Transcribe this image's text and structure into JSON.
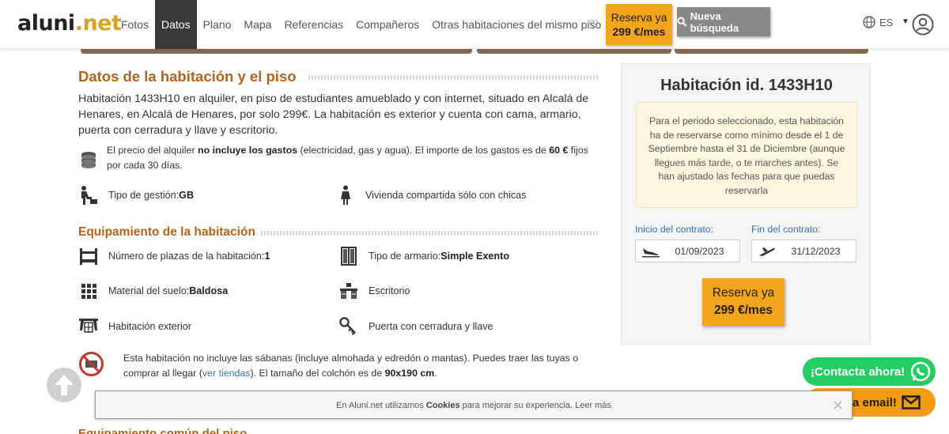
{
  "header": {
    "logo_text_left": "aluni",
    "logo_text_right": ".net",
    "nav": [
      "Fotos",
      "Datos",
      "Plano",
      "Mapa",
      "Referencias",
      "Compañeros",
      "Otras habitaciones del mismo piso"
    ],
    "active_nav": "Datos",
    "reserve_line1": "Reserva ya",
    "reserve_line2": "299 €/mes",
    "search_label": "Nueva búsqueda",
    "lang": "ES"
  },
  "section": {
    "title": "Datos de la habitación y el piso",
    "description": "Habitación 1433H10 en alquiler, en piso de estudiantes amueblado y con internet, situado en Alcalá de Henares, en Alcalá de Henares, por solo 299€. La habitación es exterior y cuenta con cama, armario, puerta con cerradura y llave y escritorio.",
    "price_note_a": "El precio del alquiler ",
    "price_note_b": "no incluye los gastos",
    "price_note_c": " (electricidad, gas y agua). El importe de los gastos es de ",
    "price_note_d": "60 €",
    "price_note_e": " fijos por cada 30 días.",
    "management_label": "Tipo de gestión: ",
    "management_value": "GB",
    "shared_label": "Vivienda compartida sólo con chicas"
  },
  "equipment": {
    "title": "Equipamiento de la habitación",
    "places_label": "Número de plazas de la habitación:",
    "places_value": "1",
    "wardrobe_label": "Tipo de armario:",
    "wardrobe_value": "Simple Exento",
    "floor_label": "Material del suelo:",
    "floor_value": "Baldosa",
    "desk_label": "Escritorio",
    "exterior_label": "Habitación exterior",
    "lock_label": "Puerta con cerradura y llave",
    "sheets_a": "Esta habitación no incluye las sábanas (incluye almohada y edredón o mantas). Puedes traer las tuyas o comprar al llegar (",
    "sheets_link": "ver tiendas",
    "sheets_b": "). El tamaño del colchón es de ",
    "sheets_c": "90x190 cm",
    "sheets_d": "."
  },
  "next_section_title": "Equipamiento común del piso",
  "sidebar": {
    "title": "Habitación id. 1433H10",
    "notice": "Para el periodo seleccionado, esta habitación ha de reservarse como mínimo desde el 1 de Septiembre hasta el 31 de Diciembre (aunque llegues más tarde, o te marches antes). Se han ajustado las fechas para que puedas reservarla",
    "start_label": "Inicio del contrato:",
    "start_value": "01/09/2023",
    "end_label": "Fin del contrato:",
    "end_value": "31/12/2023",
    "reserve_line1": "Reserva ya",
    "reserve_line2": "299 €/mes"
  },
  "floating": {
    "whatsapp_label": "¡Contacta ahora!",
    "email_label": "ta email!"
  },
  "cookie": {
    "text_a": "En Aluni.net utilizamos ",
    "text_b": "Cookies",
    "text_c": " para mejorar su experiencia. ",
    "more": "Leer más",
    "close": "✕"
  }
}
